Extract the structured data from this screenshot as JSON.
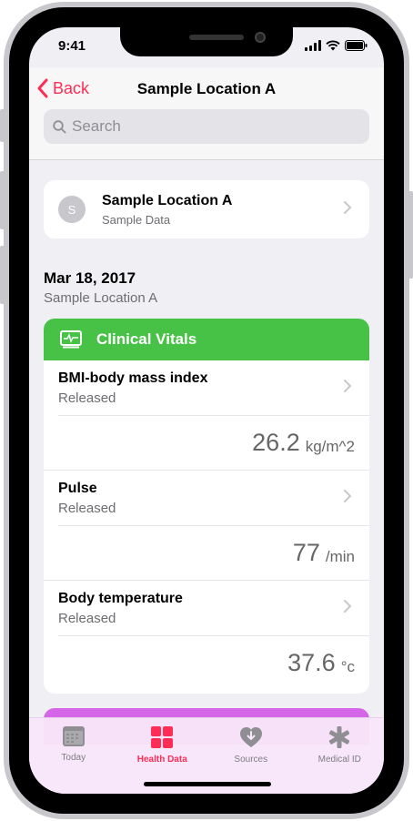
{
  "status_bar": {
    "time": "9:41"
  },
  "nav": {
    "back_label": "Back",
    "title": "Sample Location A"
  },
  "search": {
    "placeholder": "Search",
    "value": ""
  },
  "source": {
    "avatar_letter": "S",
    "name": "Sample Location A",
    "subtitle": "Sample Data"
  },
  "date_section": {
    "date": "Mar 18, 2017",
    "location": "Sample Location A"
  },
  "vitals": {
    "title": "Clinical Vitals",
    "accent_color": "#47c246",
    "records": [
      {
        "name": "BMI-body mass index",
        "status": "Released",
        "value": "26.2",
        "unit": "kg/m^2"
      },
      {
        "name": "Pulse",
        "status": "Released",
        "value": "77",
        "unit": "/min"
      },
      {
        "name": "Body temperature",
        "status": "Released",
        "value": "37.6",
        "unit": "°c"
      }
    ]
  },
  "next_card_color": "#d566e8",
  "tabs": [
    {
      "label": "Today",
      "icon": "calendar-icon",
      "active": false
    },
    {
      "label": "Health Data",
      "icon": "health-data-grid-icon",
      "active": true
    },
    {
      "label": "Sources",
      "icon": "sources-heart-icon",
      "active": false
    },
    {
      "label": "Medical ID",
      "icon": "medical-asterisk-icon",
      "active": false
    }
  ],
  "accent_color": "#ff2d55"
}
